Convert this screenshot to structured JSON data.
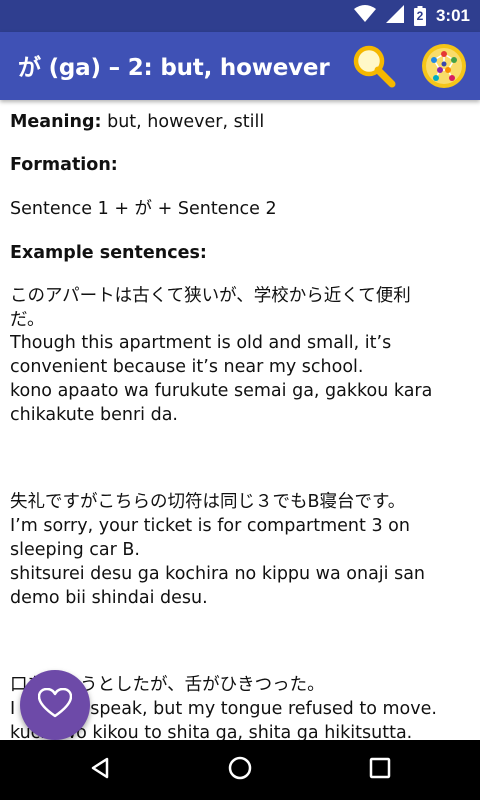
{
  "status_bar": {
    "time": "3:01",
    "battery_level": "2"
  },
  "app_bar": {
    "title": "が (ga) – 2: but, however"
  },
  "content": {
    "meaning_label": "Meaning:",
    "meaning_value": " but, however, still",
    "formation_label": "Formation:",
    "formation": "Sentence 1 + が + Sentence 2",
    "examples_label": "Example sentences:",
    "examples": [
      {
        "jp_lines": [
          "このアパートは古くて狭いが、学校から近くて便利",
          "だ。"
        ],
        "en_lines": [
          "Though this apartment is old and small, it’s",
          "convenient because it’s near my school."
        ],
        "romaji_lines": [
          "kono apaato wa furukute semai ga, gakkou kara",
          "chikakute benri da."
        ]
      },
      {
        "jp_lines": [
          "失礼ですがこちらの切符は同じ３でもB寝台です。"
        ],
        "en_lines": [
          "I’m sorry, your ticket is for compartment 3 on",
          "sleeping car B."
        ],
        "romaji_lines": [
          "shitsurei desu ga kochira no kippu wa onaji san",
          "demo bii shindai desu."
        ]
      },
      {
        "jp_lines": [
          "口をきこうとしたが、舌がひきつった。"
        ],
        "en_lines": [
          "I tried to speak, but my tongue refused to move."
        ],
        "romaji_lines": [
          "kuchi wo kikou to shita ga, shita ga hikitsutta."
        ]
      }
    ]
  },
  "icons": {
    "status": [
      "wifi-icon",
      "cell-signal-icon",
      "battery-icon"
    ],
    "app_bar": [
      "search-icon",
      "app-logo-icon"
    ],
    "fab": "heart-icon",
    "nav": [
      "back-icon",
      "home-icon",
      "recents-icon"
    ]
  },
  "colors": {
    "status_bar": "#2f3e8f",
    "app_bar": "#3f51b5",
    "fab": "#6d4aa8",
    "search_icon": "#f5b800",
    "logo": "#f5b800"
  }
}
